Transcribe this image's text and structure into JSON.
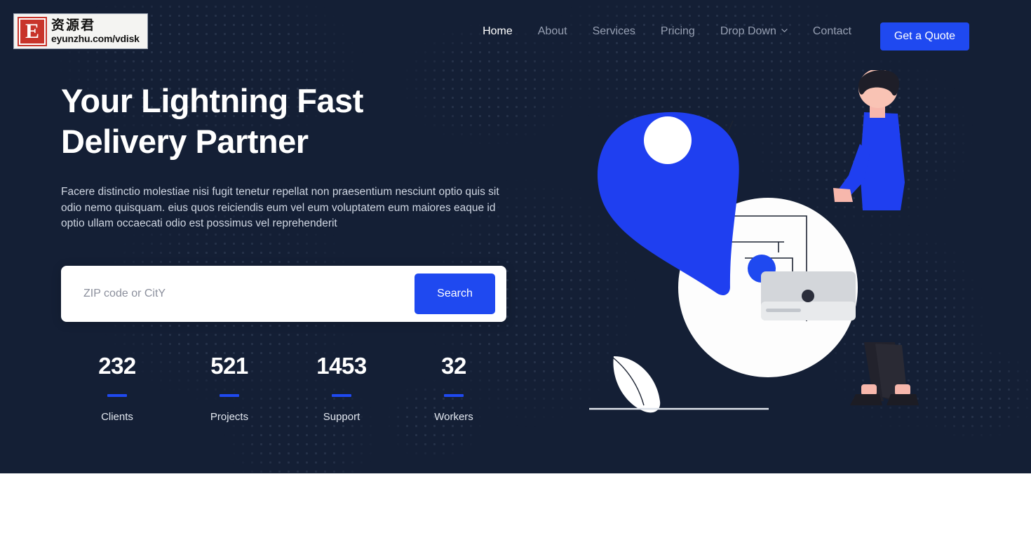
{
  "brand": {
    "logo_mark_letter": "E",
    "logo_cn": "资源君",
    "logo_url": "eyunzhu.com/vdisk"
  },
  "colors": {
    "background": "#141f35",
    "accent": "#1f49f0",
    "heading": "#ffffff",
    "muted_nav": "#97a0b3",
    "body_text": "#cfd6e2"
  },
  "nav": {
    "items": [
      {
        "label": "Home",
        "active": true,
        "has_dropdown": false
      },
      {
        "label": "About",
        "active": false,
        "has_dropdown": false
      },
      {
        "label": "Services",
        "active": false,
        "has_dropdown": false
      },
      {
        "label": "Pricing",
        "active": false,
        "has_dropdown": false
      },
      {
        "label": "Drop Down",
        "active": false,
        "has_dropdown": true
      },
      {
        "label": "Contact",
        "active": false,
        "has_dropdown": false
      }
    ],
    "cta_label": "Get a Quote",
    "dropdown_icon": "chevron-down-icon"
  },
  "hero": {
    "headline_line1": "Your Lightning Fast",
    "headline_line2": "Delivery Partner",
    "subtext": "Facere distinctio molestiae nisi fugit tenetur repellat non praesentium nesciunt optio quis sit odio nemo quisquam. eius quos reiciendis eum vel eum voluptatem eum maiores eaque id optio ullam occaecati odio est possimus vel reprehenderit",
    "search": {
      "placeholder": "ZIP code or CitY",
      "value": "",
      "button_label": "Search"
    },
    "stats": [
      {
        "value": "232",
        "label": "Clients"
      },
      {
        "value": "521",
        "label": "Projects"
      },
      {
        "value": "1453",
        "label": "Support"
      },
      {
        "value": "32",
        "label": "Workers"
      }
    ],
    "illustration": {
      "name": "delivery-illustration",
      "elements": [
        "map-pin-icon",
        "white-circle",
        "package-box",
        "delivery-person",
        "ground-line"
      ]
    }
  }
}
